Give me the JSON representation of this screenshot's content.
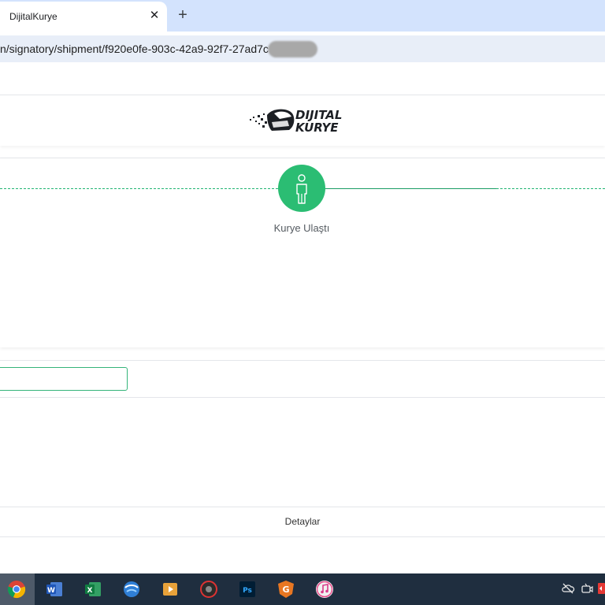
{
  "browser": {
    "tab_title": "DijitalKurye",
    "close_glyph": "✕",
    "new_tab_glyph": "+",
    "url": "n/signatory/shipment/f920e0fe-903c-42a9-92f7-27ad7c"
  },
  "logo": {
    "line1": "DIJITAL",
    "line2": "KURYE",
    "icon": "helmet-icon"
  },
  "tracking": {
    "step_icon": "person-icon",
    "step_label": "Kurye Ulaştı",
    "accent_color": "#2bbd73"
  },
  "footer": {
    "details_label": "Detaylar"
  },
  "taskbar": {
    "apps": [
      "chrome-icon",
      "word-icon",
      "excel-icon",
      "network-icon",
      "media-player-icon",
      "recorder-icon",
      "photoshop-icon",
      "g-app-icon",
      "itunes-icon"
    ],
    "word_letter": "W",
    "excel_letter": "X",
    "photoshop_label": "Ps",
    "g_letter": "G",
    "tray": [
      "cloud-offline-icon",
      "camera-icon",
      "red-tray-icon"
    ]
  }
}
